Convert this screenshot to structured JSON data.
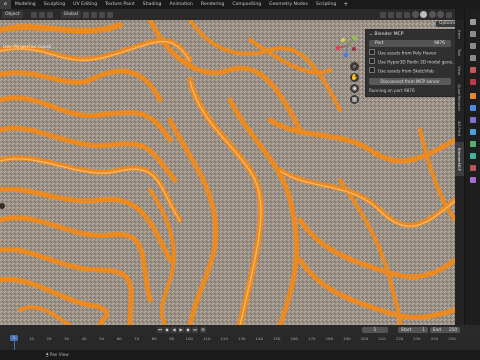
{
  "workspace_tabs": {
    "items": [
      {
        "label": "o"
      },
      {
        "label": "Modeling"
      },
      {
        "label": "Sculpting"
      },
      {
        "label": "UV Editing"
      },
      {
        "label": "Texture Paint"
      },
      {
        "label": "Shading"
      },
      {
        "label": "Animation"
      },
      {
        "label": "Rendering"
      },
      {
        "label": "Compositing"
      },
      {
        "label": "Geometry Nodes"
      },
      {
        "label": "Scripting"
      }
    ],
    "active_index": 0,
    "add_label": "+"
  },
  "viewport_header": {
    "mode_label": "Object",
    "orientation_label": "Global"
  },
  "viewport": {
    "view_label": "User Perspective (Local)"
  },
  "options_label": "Options",
  "mcp_panel": {
    "title": "Blender MCP",
    "port_label": "Port",
    "port_value": "9876",
    "checkboxes": [
      {
        "label": "Use assets from Poly Haven"
      },
      {
        "label": "Use Hyper3D Rodin 3D model gene..."
      },
      {
        "label": "Use assets from Sketchfab"
      }
    ],
    "disconnect_label": "Disconnect from MCP server",
    "status_text": "Running on port 9876"
  },
  "sidebar_tabs": [
    {
      "label": "Item"
    },
    {
      "label": "Tool"
    },
    {
      "label": "View"
    },
    {
      "label": "Quad Remesh"
    },
    {
      "label": "3D Print"
    },
    {
      "label": "BlenderMCP"
    }
  ],
  "sidebar_active_index": 5,
  "timeline": {
    "current_frame": "1",
    "start_label": "Start",
    "start_value": "1",
    "end_label": "End",
    "end_value": "250",
    "ticks": [
      "0",
      "10",
      "20",
      "30",
      "40",
      "50",
      "60",
      "70",
      "80",
      "90",
      "100",
      "110",
      "120",
      "130",
      "140",
      "150",
      "160",
      "170",
      "180",
      "190",
      "200",
      "210",
      "220",
      "230",
      "240",
      "250"
    ]
  },
  "status_bar": {
    "text": "Pan View"
  },
  "colors": {
    "accent": "#4772b3",
    "panel_bg": "#303030",
    "highlight_orange": "#f08a1c"
  }
}
